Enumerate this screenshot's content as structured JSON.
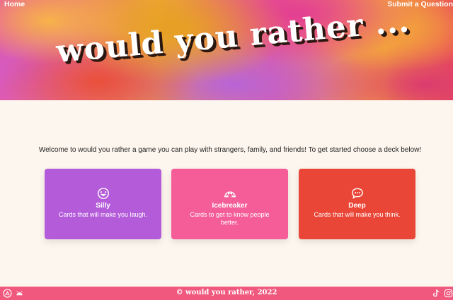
{
  "nav": {
    "home_label": "Home",
    "submit_label": "Submit a Question"
  },
  "hero": {
    "title": "would you rather ..."
  },
  "intro": {
    "text": "Welcome to would you rather a game you can play with strangers, family, and friends! To get started choose a deck below!"
  },
  "decks": [
    {
      "name": "Silly",
      "description": "Cards that will make you laugh.",
      "icon": "laughing-face-icon",
      "color": "#b45bd9"
    },
    {
      "name": "Icebreaker",
      "description": "Cards to get to know people better.",
      "icon": "igloo-icon",
      "color": "#f45d98"
    },
    {
      "name": "Deep",
      "description": "Cards that will make you think.",
      "icon": "speech-bubble-icon",
      "color": "#ea4637"
    }
  ],
  "footer": {
    "copyright": "© would you rather, 2022",
    "background": "#f0587e",
    "left_icons": [
      "app-store-icon",
      "android-icon"
    ],
    "right_icons": [
      "tiktok-icon",
      "instagram-icon"
    ]
  }
}
